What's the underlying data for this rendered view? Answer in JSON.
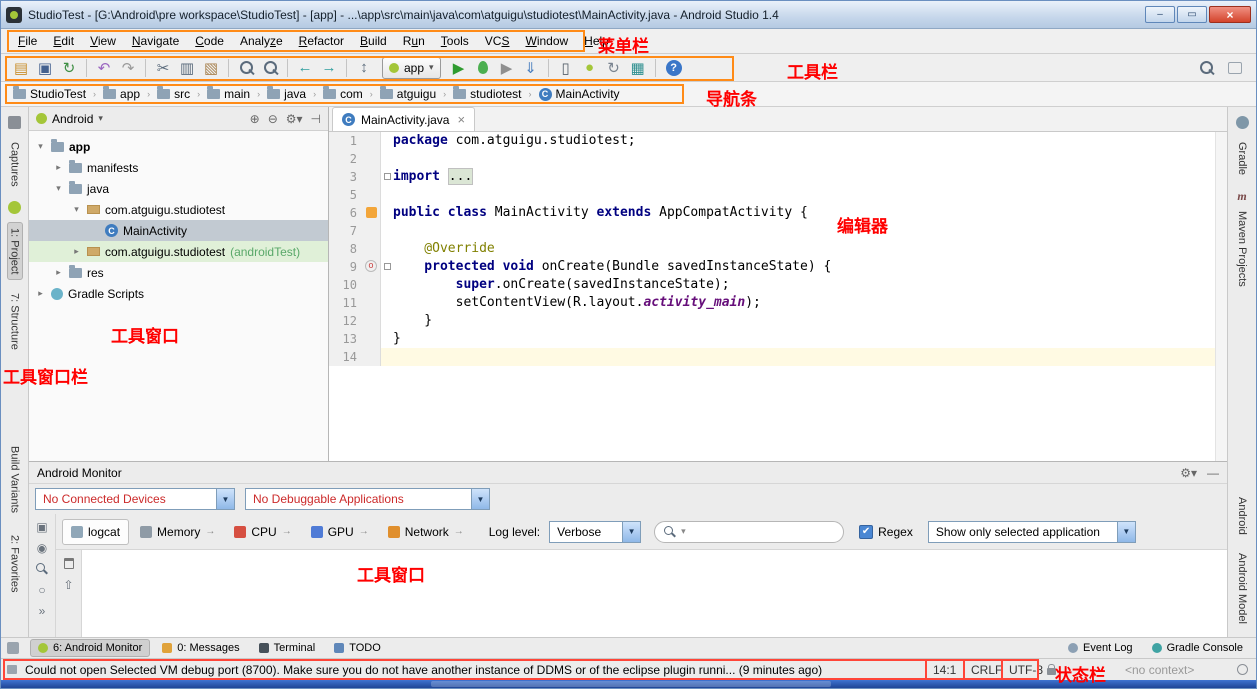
{
  "annotations": {
    "menu_bar": "菜单栏",
    "toolbar": "工具栏",
    "nav_bar": "导航条",
    "editor": "编辑器",
    "project_tool_window": "工具窗口",
    "tool_window_bar": "工具窗口栏",
    "logcat_tool_window": "工具窗口",
    "status_bar": "状态栏"
  },
  "window": {
    "title": "StudioTest - [G:\\Android\\pre workspace\\StudioTest] - [app] - ...\\app\\src\\main\\java\\com\\atguigu\\studiotest\\MainActivity.java - Android Studio 1.4"
  },
  "menu": {
    "items": [
      {
        "label": "File",
        "u": 0
      },
      {
        "label": "Edit",
        "u": 0
      },
      {
        "label": "View",
        "u": 0
      },
      {
        "label": "Navigate",
        "u": 0
      },
      {
        "label": "Code",
        "u": 0
      },
      {
        "label": "Analyze",
        "u": 5
      },
      {
        "label": "Refactor",
        "u": 0
      },
      {
        "label": "Build",
        "u": 0
      },
      {
        "label": "Run",
        "u": 1
      },
      {
        "label": "Tools",
        "u": 0
      },
      {
        "label": "VCS",
        "u": 2
      },
      {
        "label": "Window",
        "u": 0
      },
      {
        "label": "Help",
        "u": 0
      }
    ]
  },
  "toolbar": {
    "run_config_label": "app",
    "buttons": [
      {
        "type": "btn",
        "name": "open-icon",
        "glyph": "▤",
        "color": "#c98f2e"
      },
      {
        "type": "btn",
        "name": "save-icon",
        "glyph": "▣",
        "color": "#44618f"
      },
      {
        "type": "btn",
        "name": "sync-icon",
        "glyph": "↻",
        "color": "#3f8f44"
      },
      {
        "type": "sep"
      },
      {
        "type": "btn",
        "name": "undo-icon",
        "glyph": "↶",
        "color": "#9a66c0"
      },
      {
        "type": "btn",
        "name": "redo-icon",
        "glyph": "↷",
        "color": "#9a9a9a"
      },
      {
        "type": "sep"
      },
      {
        "type": "btn",
        "name": "cut-icon",
        "glyph": "✂",
        "color": "#5b6b7c"
      },
      {
        "type": "btn",
        "name": "copy-icon",
        "glyph": "▥",
        "color": "#5b6b7c"
      },
      {
        "type": "btn",
        "name": "paste-icon",
        "glyph": "▧",
        "color": "#a8824f"
      },
      {
        "type": "sep"
      },
      {
        "type": "mag",
        "name": "find-icon"
      },
      {
        "type": "mag",
        "name": "replace-icon"
      },
      {
        "type": "sep"
      },
      {
        "type": "btn",
        "name": "back-icon",
        "glyph": "←",
        "color": "#2f9e9e"
      },
      {
        "type": "btn",
        "name": "forward-icon",
        "glyph": "→",
        "color": "#2f9e9e"
      },
      {
        "type": "sep"
      },
      {
        "type": "btn",
        "name": "updown-icon",
        "glyph": "↕",
        "color": "#5b6b7c"
      },
      {
        "type": "combo",
        "name": "run-config-combo"
      },
      {
        "type": "btn",
        "name": "run-icon",
        "glyph": "▶",
        "color": "#2f9b2f"
      },
      {
        "type": "bug",
        "name": "debug-icon"
      },
      {
        "type": "btn",
        "name": "coverage-icon",
        "glyph": "▶",
        "color": "#8f8f8f"
      },
      {
        "type": "btn",
        "name": "attach-debugger-icon",
        "glyph": "⇓",
        "color": "#4a7fbf"
      },
      {
        "type": "sep"
      },
      {
        "type": "btn",
        "name": "avd-manager-icon",
        "glyph": "▯",
        "color": "#56606b"
      },
      {
        "type": "btn",
        "name": "sdk-manager-icon",
        "glyph": "●",
        "color": "#a4c639"
      },
      {
        "type": "btn",
        "name": "gradle-sync-icon",
        "glyph": "↻",
        "color": "#7a8490"
      },
      {
        "type": "btn",
        "name": "android-monitor-icon",
        "glyph": "▦",
        "color": "#2d8f8f"
      },
      {
        "type": "sep"
      },
      {
        "type": "btn",
        "name": "help-icon",
        "glyph": "?",
        "color": "#ffffff",
        "cls": "help"
      }
    ]
  },
  "navbar": {
    "crumbs": [
      {
        "label": "StudioTest",
        "icon": "folder"
      },
      {
        "label": "app",
        "icon": "folder"
      },
      {
        "label": "src",
        "icon": "folder"
      },
      {
        "label": "main",
        "icon": "folder"
      },
      {
        "label": "java",
        "icon": "folder"
      },
      {
        "label": "com",
        "icon": "folder"
      },
      {
        "label": "atguigu",
        "icon": "folder"
      },
      {
        "label": "studiotest",
        "icon": "folder"
      },
      {
        "label": "MainActivity",
        "icon": "class"
      }
    ]
  },
  "left_bar": {
    "items": [
      {
        "label": "Captures"
      },
      {
        "label": "1: Project"
      },
      {
        "label": "7: Structure"
      },
      {
        "label": "Build Variants"
      },
      {
        "label": "2: Favorites"
      }
    ]
  },
  "right_bar": {
    "items": [
      {
        "label": "Gradle"
      },
      {
        "label": "Maven Projects"
      },
      {
        "label": "Android"
      },
      {
        "label": "Android Model"
      }
    ]
  },
  "project": {
    "scope": "Android",
    "tree": [
      {
        "label": "app"
      },
      {
        "label": "manifests"
      },
      {
        "label": "java"
      },
      {
        "label": "com.atguigu.studiotest"
      },
      {
        "label": "MainActivity"
      },
      {
        "label": "com.atguigu.studiotest",
        "suffix": " (androidTest)"
      },
      {
        "label": "res"
      },
      {
        "label": "Gradle Scripts"
      }
    ]
  },
  "editor": {
    "tab_title": "MainActivity.java",
    "lines": [
      {
        "n": "1"
      },
      {
        "n": "2"
      },
      {
        "n": "3"
      },
      {
        "n": "5"
      },
      {
        "n": "6"
      },
      {
        "n": "7"
      },
      {
        "n": "8"
      },
      {
        "n": "9"
      },
      {
        "n": "10"
      },
      {
        "n": "11"
      },
      {
        "n": "12"
      },
      {
        "n": "13"
      },
      {
        "n": "14"
      }
    ],
    "code": {
      "l1_kw": "package ",
      "l1_pl": "com.atguigu.studiotest;",
      "l3_kw": "import ",
      "l3_fold": "...",
      "l6_kw1": "public class ",
      "l6_pl1": "MainActivity ",
      "l6_kw2": "extends ",
      "l6_pl2": "AppCompatActivity {",
      "l8_ann": "    @Override",
      "l9_kw": "    protected void ",
      "l9_pl": "onCreate(Bundle savedInstanceState) {",
      "l10_pl1": "        ",
      "l10_kw": "super",
      "l10_pl2": ".onCreate(savedInstanceState);",
      "l11_pl1": "        setContentView(R.layout.",
      "l11_field": "activity_main",
      "l11_pl2": ");",
      "l12_pl": "    }",
      "l13_pl": "}"
    }
  },
  "monitor": {
    "title": "Android Monitor",
    "device_combo": "No Connected Devices",
    "app_combo": "No Debuggable Applications",
    "tabs": [
      {
        "label": "logcat"
      },
      {
        "label": "Memory"
      },
      {
        "label": "CPU"
      },
      {
        "label": "GPU"
      },
      {
        "label": "Network"
      }
    ],
    "log_level_label": "Log level:",
    "log_level_value": "Verbose",
    "regex_label": "Regex",
    "filter_combo": "Show only selected application"
  },
  "bottom_bar": {
    "tabs": [
      {
        "label": "6: Android Monitor"
      },
      {
        "label": "0: Messages"
      },
      {
        "label": "Terminal"
      },
      {
        "label": "TODO"
      }
    ],
    "right": [
      {
        "label": "Event Log"
      },
      {
        "label": "Gradle Console"
      }
    ]
  },
  "status": {
    "message": "Could not open Selected VM debug port (8700). Make sure you do not have another instance of DDMS or of the eclipse plugin runni... (9 minutes ago)",
    "caret": "14:1",
    "line_sep": "CRLF",
    "encoding": "UTF-8",
    "context": "<no context>"
  }
}
